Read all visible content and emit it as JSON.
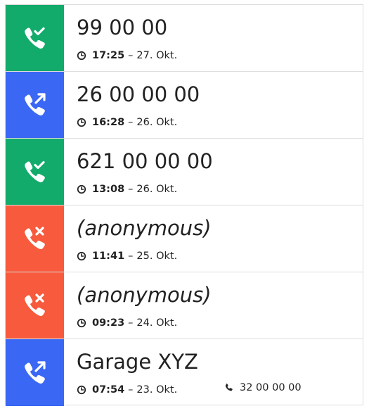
{
  "colors": {
    "answered": "#12ab6b",
    "outgoing": "#3a68f5",
    "missed": "#f75a3c",
    "text": "#222222",
    "divider": "#dddddd"
  },
  "calls": [
    {
      "status": "answered",
      "icon": "phone-check-icon",
      "caller": "99 00 00",
      "time": "17:25",
      "sep": "–",
      "date": "27. Okt."
    },
    {
      "status": "outgoing",
      "icon": "phone-outgoing-icon",
      "caller": "26 00 00 00",
      "time": "16:28",
      "sep": "–",
      "date": "26. Okt."
    },
    {
      "status": "answered",
      "icon": "phone-check-icon",
      "caller": "621 00 00 00",
      "time": "13:08",
      "sep": "–",
      "date": "26. Okt."
    },
    {
      "status": "missed",
      "icon": "phone-missed-icon",
      "caller": "(anonymous)",
      "time": "11:41",
      "sep": "–",
      "date": "25. Okt."
    },
    {
      "status": "missed",
      "icon": "phone-missed-icon",
      "caller": "(anonymous)",
      "time": "09:23",
      "sep": "–",
      "date": "24. Okt."
    },
    {
      "status": "outgoing",
      "icon": "phone-outgoing-icon",
      "caller": "Garage XYZ",
      "time": "07:54",
      "sep": "–",
      "date": "23. Okt.",
      "number": "32 00 00 00"
    }
  ]
}
